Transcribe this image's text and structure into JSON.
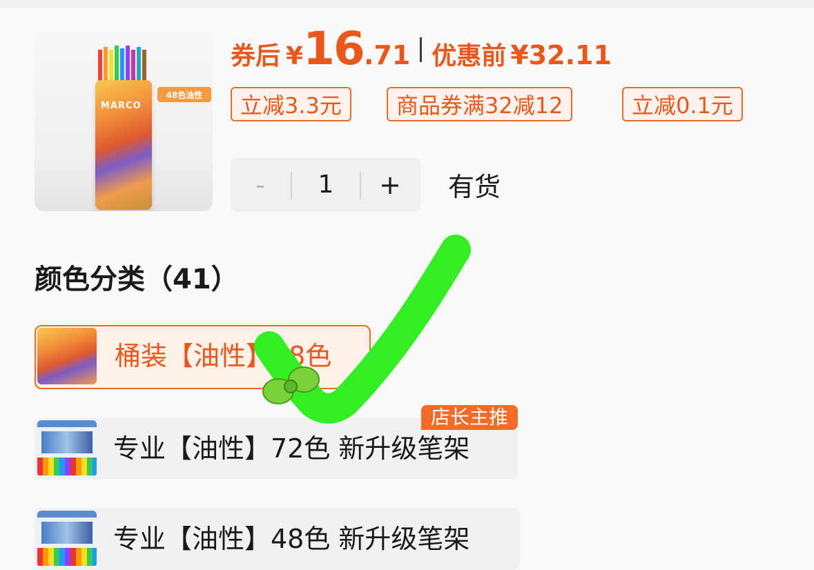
{
  "product": {
    "image_brand": "MARCO",
    "image_badge": "48色油性"
  },
  "price": {
    "after_label": "券后",
    "currency": "¥",
    "after_int": "16",
    "after_dec": ".71",
    "before_label": "优惠前",
    "before_value": "¥32.11"
  },
  "coupons": [
    "立减3.3元",
    "商品券满32减12",
    "立减0.1元"
  ],
  "quantity": {
    "minus": "-",
    "value": "1",
    "plus": "+",
    "stock": "有货"
  },
  "variants": {
    "title": "颜色分类（41）",
    "items": [
      {
        "label": "桶装【油性】48色",
        "selected": true
      },
      {
        "label": "专业【油性】72色 新升级笔架",
        "badge": "店长主推"
      },
      {
        "label": "专业【油性】48色 新升级笔架"
      }
    ]
  },
  "colors": {
    "accent": "#e8571c",
    "badge_bg": "#f36b27",
    "check_green": "#33ee22"
  },
  "icons": [
    "minus-icon",
    "plus-icon",
    "checkmark-icon",
    "bow-icon"
  ]
}
